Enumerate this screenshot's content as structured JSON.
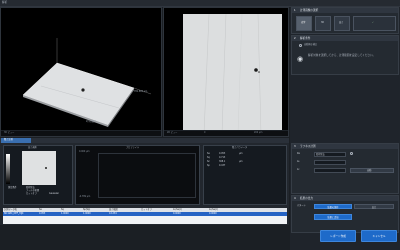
{
  "window": {
    "title": "解析"
  },
  "viewport_left": {
    "axis_x_label": "781.802 µm",
    "axis_y_label": "2月の高さ",
    "footer_text": "3D ビュー"
  },
  "viewport_right": {
    "footer_left": "2D ビュー",
    "footer_mid": "0",
    "footer_right": "200 µm"
  },
  "side_panel": {
    "section1": {
      "number": "1",
      "title": "計測画像の選択",
      "btn_a": "光学",
      "btn_b": "3D",
      "btn_c": "高さ",
      "btn_d": "✓"
    },
    "section2": {
      "number": "2",
      "title": "解析条件",
      "toggle_label": "自動傾き補正",
      "hint": "解析対象を選択してから、計測範囲を設定してください。"
    },
    "section3": {
      "number": "3",
      "title": "ラフネス計測",
      "rows": [
        {
          "label": "Ra",
          "value": "形状除去",
          "value2": ""
        },
        {
          "label": "λs",
          "value": "",
          "value2": ""
        },
        {
          "label": "λc",
          "value": "",
          "value2": "自動"
        }
      ]
    },
    "section4": {
      "number": "4",
      "title": "結果の出力",
      "rows": [
        {
          "label": "パターン",
          "value": ""
        },
        {
          "label": "",
          "value": ""
        }
      ],
      "action_a": "結果の保存",
      "action_b": "出力",
      "action_button": "結果に追加"
    }
  },
  "bottom": {
    "tab_active": "粗さ計測",
    "panels": {
      "mini_title": "高さ画像",
      "profile_title": "プロファイル",
      "profile_top_value": "0.000 µm",
      "profile_bottom_value": "-0.789 µm",
      "params_title": "粗さパラメータ",
      "params": [
        {
          "name": "Sa",
          "value": "0.053",
          "unit": "µm"
        },
        {
          "name": "Sq",
          "value": "0.713",
          "unit": ""
        },
        {
          "name": "Sz",
          "value": "308.1",
          "unit": "µm"
        },
        {
          "name": "Sp",
          "value": "0.437",
          "unit": ""
        }
      ],
      "filter_label": "測定条件",
      "filter_lines": [
        "形状除去",
        "フィルタ処理",
        "カットオフ"
      ],
      "filter_value": "Gaussian"
    },
    "table": {
      "headers": [
        "計測データ名",
        "Sa",
        "Sq",
        "Sp(Sp)",
        "高さ範囲",
        "カットオフ",
        "λc/λs(λ)",
        "λc/λs(λ)"
      ],
      "rows": [
        [
          "NO ABC_DEF_HIJK",
          "0.053",
          "1.0000",
          "1.0000",
          "0.1234",
          "",
          "0.0000",
          "0.0000"
        ]
      ]
    },
    "buttons": {
      "report": "レポート作成",
      "cancel": "キャンセル"
    }
  }
}
